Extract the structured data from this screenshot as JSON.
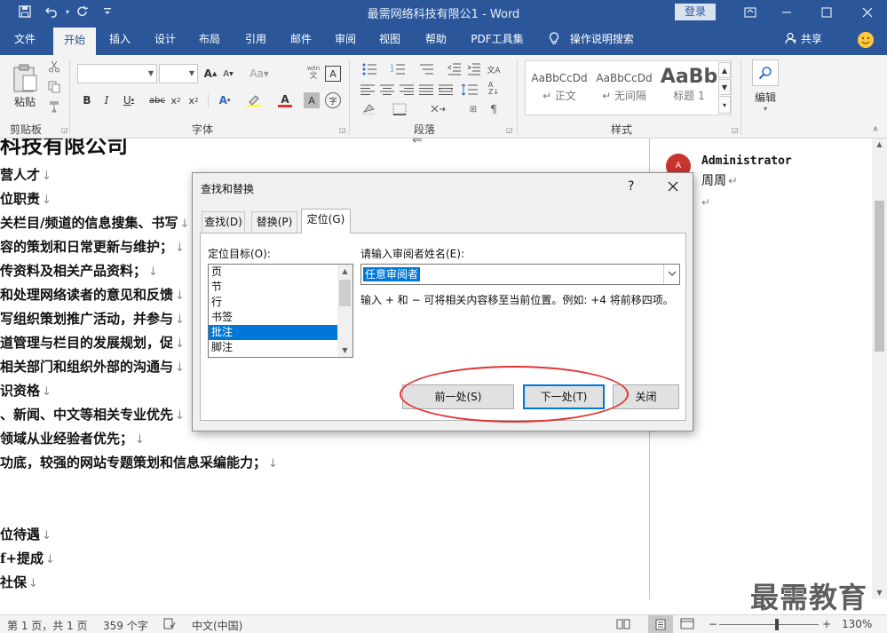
{
  "window": {
    "title": "最需网络科技有限公1  -  Word",
    "login_label": "登录",
    "qa_icons": [
      "save-icon",
      "undo-icon",
      "redo-icon",
      "customize-icon"
    ]
  },
  "tabs": [
    "文件",
    "开始",
    "插入",
    "设计",
    "布局",
    "引用",
    "邮件",
    "审阅",
    "视图",
    "帮助",
    "PDF工具集"
  ],
  "active_tab": "开始",
  "tellme_label": "操作说明搜索",
  "share_label": "共享",
  "ribbon": {
    "clipboard": {
      "paste_label": "粘贴",
      "group_label": "剪贴板"
    },
    "font": {
      "group_label": "字体",
      "font_name": "",
      "font_size": ""
    },
    "paragraph": {
      "group_label": "段落"
    },
    "styles": {
      "group_label": "样式",
      "items": [
        {
          "sample": "AaBbCcDd",
          "name": "↵ 正文"
        },
        {
          "sample": "AaBbCcDd",
          "name": "↵ 无间隔"
        },
        {
          "sample": "AaBb",
          "name": "标题 1"
        }
      ]
    },
    "editing": {
      "label": "编辑"
    }
  },
  "document": {
    "heading": "科技有限公司",
    "lines": [
      "营人才",
      "位职责",
      "关栏目/频道的信息搜集、书写",
      "容的策划和日常更新与维护；",
      "传资料及相关产品资料；",
      "和处理网络读者的意见和反馈",
      "写组织策划推广活动，并参与",
      "道管理与栏目的发展规划，促",
      "相关部门和组织外部的沟通与",
      "识资格",
      "、新闻、中文等相关专业优先",
      "领域从业经验者优先；",
      "功底，较强的网站专题策划和信息采编能力；",
      "",
      "",
      "位待遇",
      "f+提成",
      "社保"
    ],
    "para_mark": "↓"
  },
  "comment": {
    "avatar_initial": "A",
    "author": "Administrator",
    "text": "周周",
    "text_mark": "↵",
    "empty_mark": "↵"
  },
  "watermark": "最需教育",
  "statusbar": {
    "page": "第 1 页，共 1 页",
    "words": "359 个字",
    "language": "中文(中国)",
    "zoom": "130%"
  },
  "dialog": {
    "title": "查找和替换",
    "help": "?",
    "tabs": [
      "查找(D)",
      "替换(P)",
      "定位(G)"
    ],
    "active_tab": "定位(G)",
    "target_label": "定位目标(O):",
    "targets": [
      "页",
      "节",
      "行",
      "书签",
      "批注",
      "脚注"
    ],
    "selected_target": "批注",
    "name_label": "请输入审阅者姓名(E):",
    "name_value": "任意审阅者",
    "hint": "输入 + 和 − 可将相关内容移至当前位置。例如: +4 将前移四项。",
    "buttons": {
      "previous": "前一处(S)",
      "next": "下一处(T)",
      "close": "关闭"
    }
  }
}
